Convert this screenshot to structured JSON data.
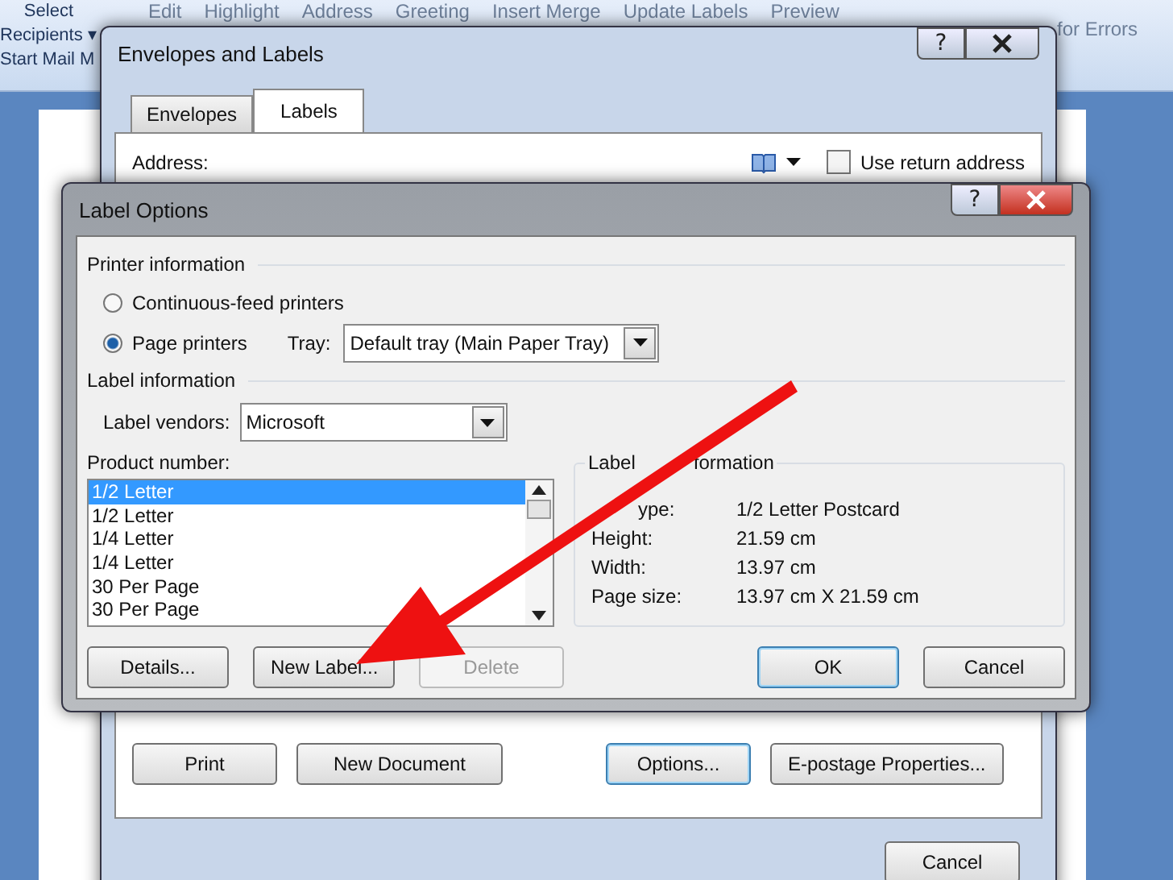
{
  "ribbon": {
    "left": [
      "Select",
      "Recipients ▾",
      "Start Mail M"
    ],
    "top": [
      "Edit",
      "Highlight",
      "Address",
      "Greeting",
      "Insert Merge",
      "Update Labels",
      "Preview"
    ],
    "right": [
      "for Errors"
    ]
  },
  "envelopes_dialog": {
    "title": "Envelopes and Labels",
    "help": "?",
    "tabs": [
      {
        "label": "Envelopes",
        "selected": false
      },
      {
        "label": "Labels",
        "selected": true
      }
    ],
    "address_label": "Address:",
    "use_return_address": {
      "label": "Use return address",
      "checked": false
    },
    "buttons": [
      {
        "label": "Print",
        "default": false
      },
      {
        "label": "New Document",
        "default": false
      },
      {
        "label": "Options...",
        "default": true
      },
      {
        "label": "E-postage Properties...",
        "default": false
      }
    ],
    "cancel": "Cancel"
  },
  "label_options": {
    "title": "Label Options",
    "help": "?",
    "printer_information": {
      "heading": "Printer information",
      "options": [
        {
          "label": "Continuous-feed printers",
          "selected": false
        },
        {
          "label": "Page printers",
          "selected": true
        }
      ],
      "tray_label": "Tray:",
      "tray": "Default tray (Main Paper Tray)"
    },
    "label_information": {
      "heading": "Label information",
      "vendors_label": "Label vendors:",
      "vendor": "Microsoft"
    },
    "product_number": {
      "label": "Product number:",
      "items": [
        {
          "label": "1/2 Letter",
          "selected": true
        },
        {
          "label": "1/2 Letter",
          "selected": false
        },
        {
          "label": "1/4 Letter",
          "selected": false
        },
        {
          "label": "1/4 Letter",
          "selected": false
        },
        {
          "label": "30 Per Page",
          "selected": false
        },
        {
          "label": "30 Per Page",
          "selected": false
        }
      ]
    },
    "details": {
      "heading_parts": [
        "Label",
        "formation"
      ],
      "rows": [
        {
          "name": "ype:",
          "value": "1/2 Letter Postcard"
        },
        {
          "name": "Height:",
          "value": "21.59 cm"
        },
        {
          "name": "Width:",
          "value": "13.97 cm"
        },
        {
          "name": "Page size:",
          "value": "13.97 cm X 21.59 cm"
        }
      ]
    },
    "buttons": [
      {
        "label": "Details...",
        "disabled": false
      },
      {
        "label": "New Label...",
        "disabled": false
      },
      {
        "label": "Delete",
        "disabled": true
      }
    ],
    "actions": [
      {
        "label": "OK",
        "default": true
      },
      {
        "label": "Cancel",
        "default": false
      }
    ]
  }
}
